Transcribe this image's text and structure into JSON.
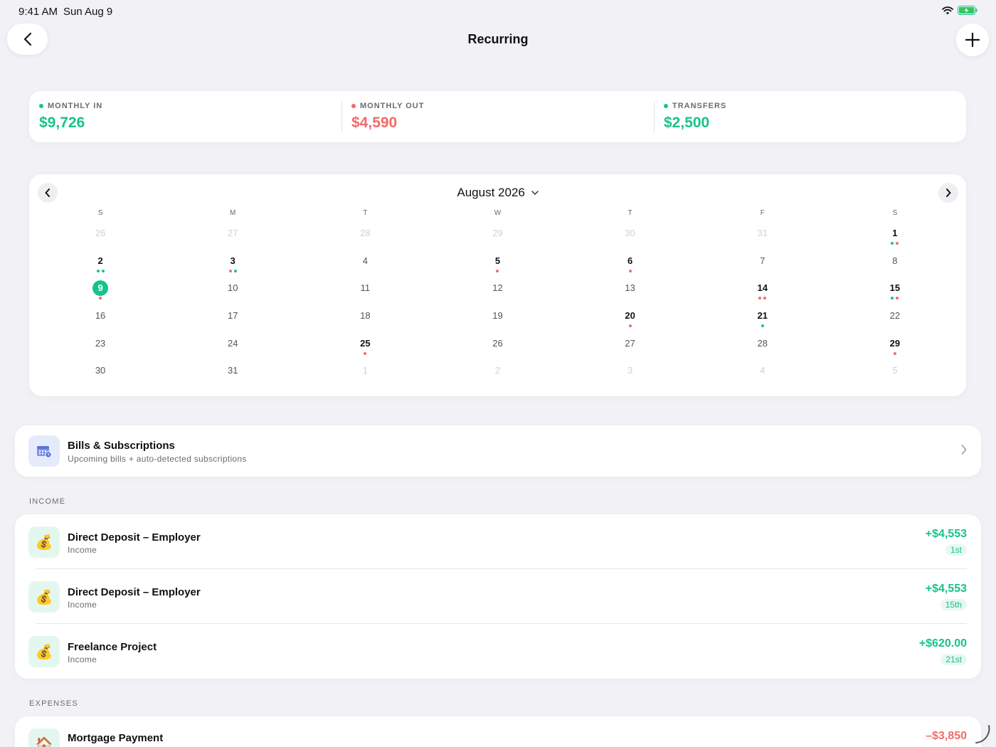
{
  "status": {
    "time": "9:41 AM",
    "date": "Sun Aug 9"
  },
  "nav": {
    "title": "Recurring"
  },
  "summary": [
    {
      "label": "MONTHLY IN",
      "value": "$9,726",
      "color": "#18c28d"
    },
    {
      "label": "MONTHLY OUT",
      "value": "$4,590",
      "color": "#f26b6b"
    },
    {
      "label": "TRANSFERS",
      "value": "$2,500",
      "color": "#18c28d"
    }
  ],
  "calendar": {
    "month_label": "August 2026",
    "weekdays": [
      "S",
      "M",
      "T",
      "W",
      "T",
      "F",
      "S"
    ],
    "weeks": [
      [
        {
          "d": "26",
          "muted": true
        },
        {
          "d": "27",
          "muted": true
        },
        {
          "d": "28",
          "muted": true
        },
        {
          "d": "29",
          "muted": true
        },
        {
          "d": "30",
          "muted": true
        },
        {
          "d": "31",
          "muted": true
        },
        {
          "d": "1",
          "bold": true,
          "dots": [
            "g",
            "r"
          ]
        }
      ],
      [
        {
          "d": "2",
          "bold": true,
          "dots": [
            "g",
            "g"
          ]
        },
        {
          "d": "3",
          "bold": true,
          "dots": [
            "r",
            "g"
          ]
        },
        {
          "d": "4"
        },
        {
          "d": "5",
          "bold": true,
          "dots": [
            "r"
          ]
        },
        {
          "d": "6",
          "bold": true,
          "dots": [
            "r"
          ]
        },
        {
          "d": "7"
        },
        {
          "d": "8"
        }
      ],
      [
        {
          "d": "9",
          "today": true,
          "dots": [
            "r"
          ]
        },
        {
          "d": "10"
        },
        {
          "d": "11"
        },
        {
          "d": "12"
        },
        {
          "d": "13"
        },
        {
          "d": "14",
          "bold": true,
          "dots": [
            "r",
            "r"
          ]
        },
        {
          "d": "15",
          "bold": true,
          "dots": [
            "g",
            "r"
          ]
        }
      ],
      [
        {
          "d": "16"
        },
        {
          "d": "17"
        },
        {
          "d": "18"
        },
        {
          "d": "19"
        },
        {
          "d": "20",
          "bold": true,
          "dots": [
            "r"
          ]
        },
        {
          "d": "21",
          "bold": true,
          "dots": [
            "g"
          ]
        },
        {
          "d": "22"
        }
      ],
      [
        {
          "d": "23"
        },
        {
          "d": "24"
        },
        {
          "d": "25",
          "bold": true,
          "dots": [
            "r"
          ]
        },
        {
          "d": "26"
        },
        {
          "d": "27"
        },
        {
          "d": "28"
        },
        {
          "d": "29",
          "bold": true,
          "dots": [
            "r"
          ]
        }
      ],
      [
        {
          "d": "30"
        },
        {
          "d": "31"
        },
        {
          "d": "1",
          "muted": true
        },
        {
          "d": "2",
          "muted": true
        },
        {
          "d": "3",
          "muted": true
        },
        {
          "d": "4",
          "muted": true
        },
        {
          "d": "5",
          "muted": true
        }
      ]
    ]
  },
  "bills": {
    "title": "Bills & Subscriptions",
    "subtitle": "Upcoming bills + auto-detected subscriptions"
  },
  "income": {
    "section_label": "INCOME",
    "items": [
      {
        "name": "Direct Deposit – Employer",
        "category": "Income",
        "amount": "+$4,553",
        "date": "1st",
        "icon": "money-bag-icon",
        "glyph": "💰"
      },
      {
        "name": "Direct Deposit – Employer",
        "category": "Income",
        "amount": "+$4,553",
        "date": "15th",
        "icon": "money-bag-icon",
        "glyph": "💰"
      },
      {
        "name": "Freelance Project",
        "category": "Income",
        "amount": "+$620.00",
        "date": "21st",
        "icon": "money-bag-icon",
        "glyph": "💰"
      }
    ]
  },
  "expenses": {
    "section_label": "EXPENSES",
    "items": [
      {
        "name": "Mortgage Payment",
        "amount": "–$3,850",
        "icon": "house-icon",
        "glyph": "🏠"
      }
    ]
  }
}
